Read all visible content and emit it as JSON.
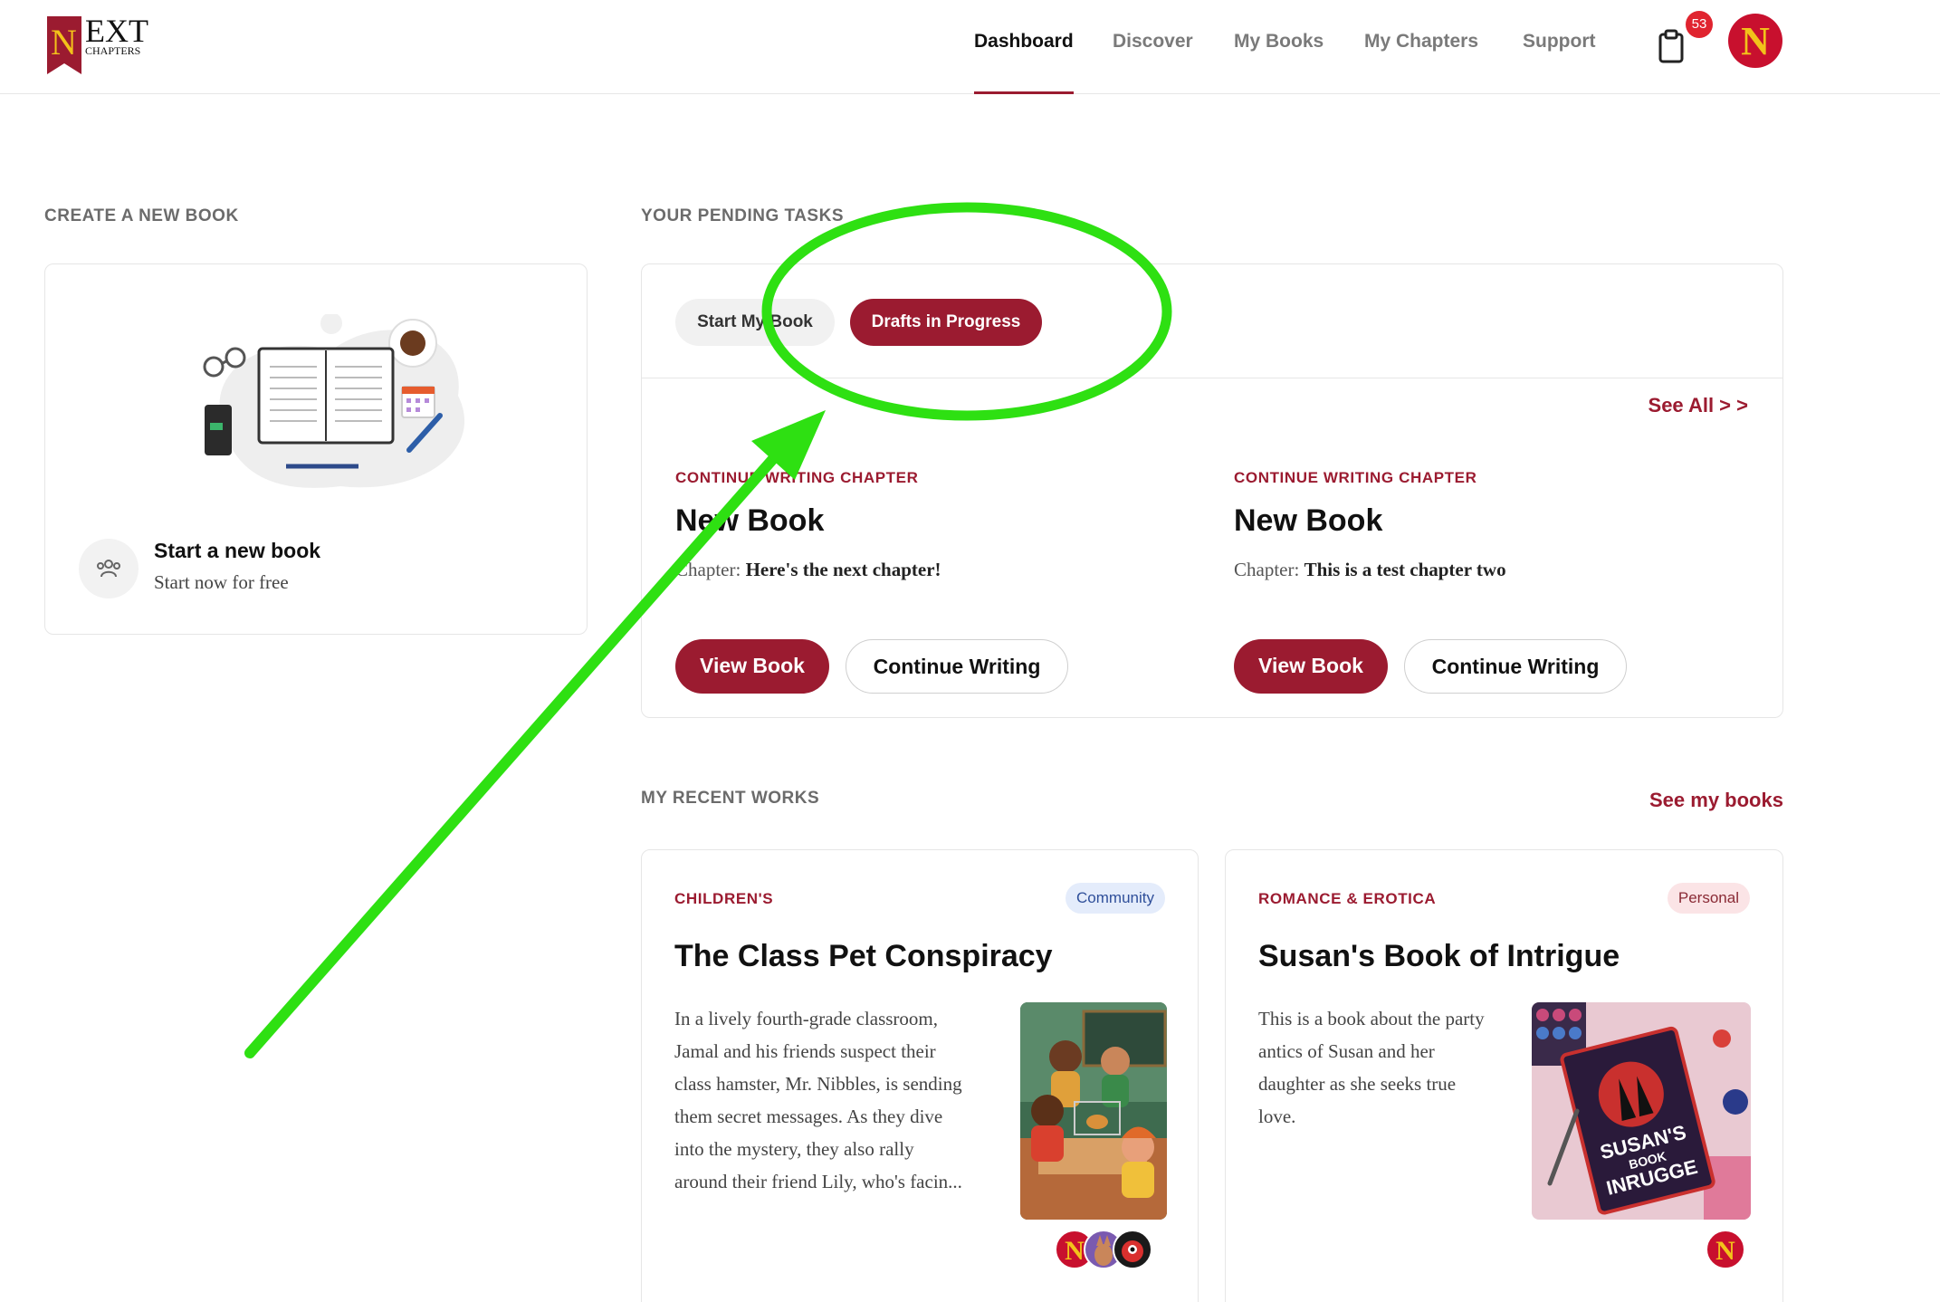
{
  "brand": {
    "logo_letter": "N",
    "logo_text": "EXT",
    "logo_sub": "CHAPTERS",
    "primary_color": "#9b1b30",
    "accent_gold": "#f2c21a"
  },
  "nav": {
    "items": [
      {
        "label": "Dashboard",
        "active": true
      },
      {
        "label": "Discover",
        "active": false
      },
      {
        "label": "My Books",
        "active": false
      },
      {
        "label": "My Chapters",
        "active": false
      },
      {
        "label": "Support",
        "active": false
      }
    ],
    "notification_count": "53",
    "clipboard_icon": "clipboard-icon",
    "avatar_letter": "N"
  },
  "create": {
    "section_label": "CREATE A NEW BOOK",
    "title": "Start a new book",
    "subtitle": "Start now for free",
    "icon": "people-icon"
  },
  "pending": {
    "section_label": "YOUR PENDING TASKS",
    "tabs": [
      {
        "label": "Start My Book",
        "active": false
      },
      {
        "label": "Drafts in Progress",
        "active": true
      }
    ],
    "see_all": "See All > >",
    "drafts": [
      {
        "kicker": "CONTINUE WRITING CHAPTER",
        "title": "New Book",
        "chapter_label": "Chapter:",
        "chapter_name": "Here's the next chapter!",
        "view_label": "View Book",
        "continue_label": "Continue Writing"
      },
      {
        "kicker": "CONTINUE WRITING CHAPTER",
        "title": "New Book",
        "chapter_label": "Chapter:",
        "chapter_name": "This is a test chapter two",
        "view_label": "View Book",
        "continue_label": "Continue Writing"
      }
    ]
  },
  "recent": {
    "section_label": "MY RECENT WORKS",
    "see_books": "See my books",
    "books": [
      {
        "category": "CHILDREN'S",
        "tag": "Community",
        "title": "The Class Pet Conspiracy",
        "description_lines": [
          "In a lively fourth-grade classroom,",
          "Jamal and his friends suspect their",
          "class hamster, Mr. Nibbles, is sending",
          "them secret messages. As they dive",
          "into the mystery, they also rally",
          "around their friend Lily, who's facin..."
        ]
      },
      {
        "category": "ROMANCE & EROTICA",
        "tag": "Personal",
        "title": "Susan's Book of Intrigue",
        "description_lines": [
          "This is a book about the party",
          "antics of Susan and her",
          "daughter as she seeks true",
          "love."
        ],
        "cover_text": [
          "SUSAN'S",
          "BOOK",
          "INRUGGE"
        ]
      }
    ]
  },
  "annotation": {
    "color": "#2ee012",
    "shapes": [
      "ellipse-highlight",
      "arrow"
    ]
  }
}
